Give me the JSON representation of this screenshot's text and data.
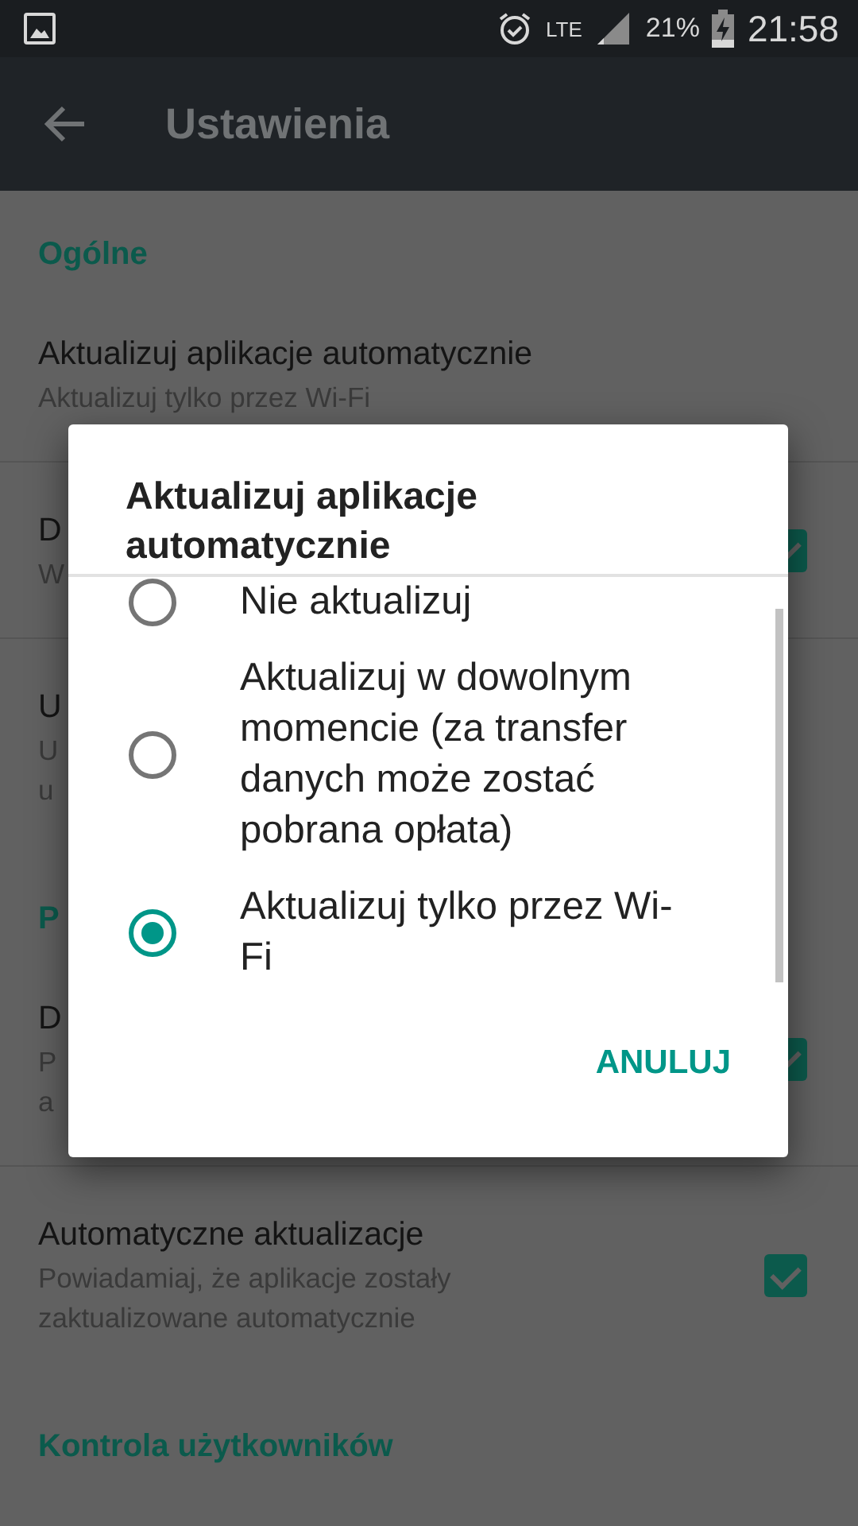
{
  "status_bar": {
    "network": "LTE",
    "battery": "21%",
    "time": "21:58"
  },
  "header": {
    "title": "Ustawienia"
  },
  "sections": [
    {
      "kind": "header",
      "title": "Ogólne"
    },
    {
      "kind": "row",
      "title": "Aktualizuj aplikacje automatycznie",
      "subtitle": [
        "Aktualizuj tylko przez Wi-Fi"
      ]
    },
    {
      "kind": "row",
      "title": "D",
      "subtitle": [
        "W"
      ],
      "checked": true
    },
    {
      "kind": "row",
      "title": "U",
      "subtitle": [
        "U",
        "u"
      ]
    },
    {
      "kind": "header",
      "title": "P"
    },
    {
      "kind": "row",
      "title": "D",
      "subtitle": [
        "P",
        "a"
      ],
      "checked": true
    },
    {
      "kind": "row",
      "title": "Automatyczne aktualizacje",
      "subtitle": [
        "Powiadamiaj, że aplikacje zostały",
        "zaktualizowane automatycznie"
      ],
      "checked": true
    },
    {
      "kind": "header",
      "title": "Kontrola użytkowników"
    }
  ],
  "dialog": {
    "title": "Aktualizuj aplikacje automatycznie",
    "options": [
      {
        "label": "Nie aktualizuj",
        "selected": false
      },
      {
        "label": "Aktualizuj w dowolnym momencie (za transfer danych może zostać pobrana opłata)",
        "selected": false
      },
      {
        "label": "Aktualizuj tylko przez Wi-Fi",
        "selected": true
      }
    ],
    "button": "ANULUJ"
  }
}
